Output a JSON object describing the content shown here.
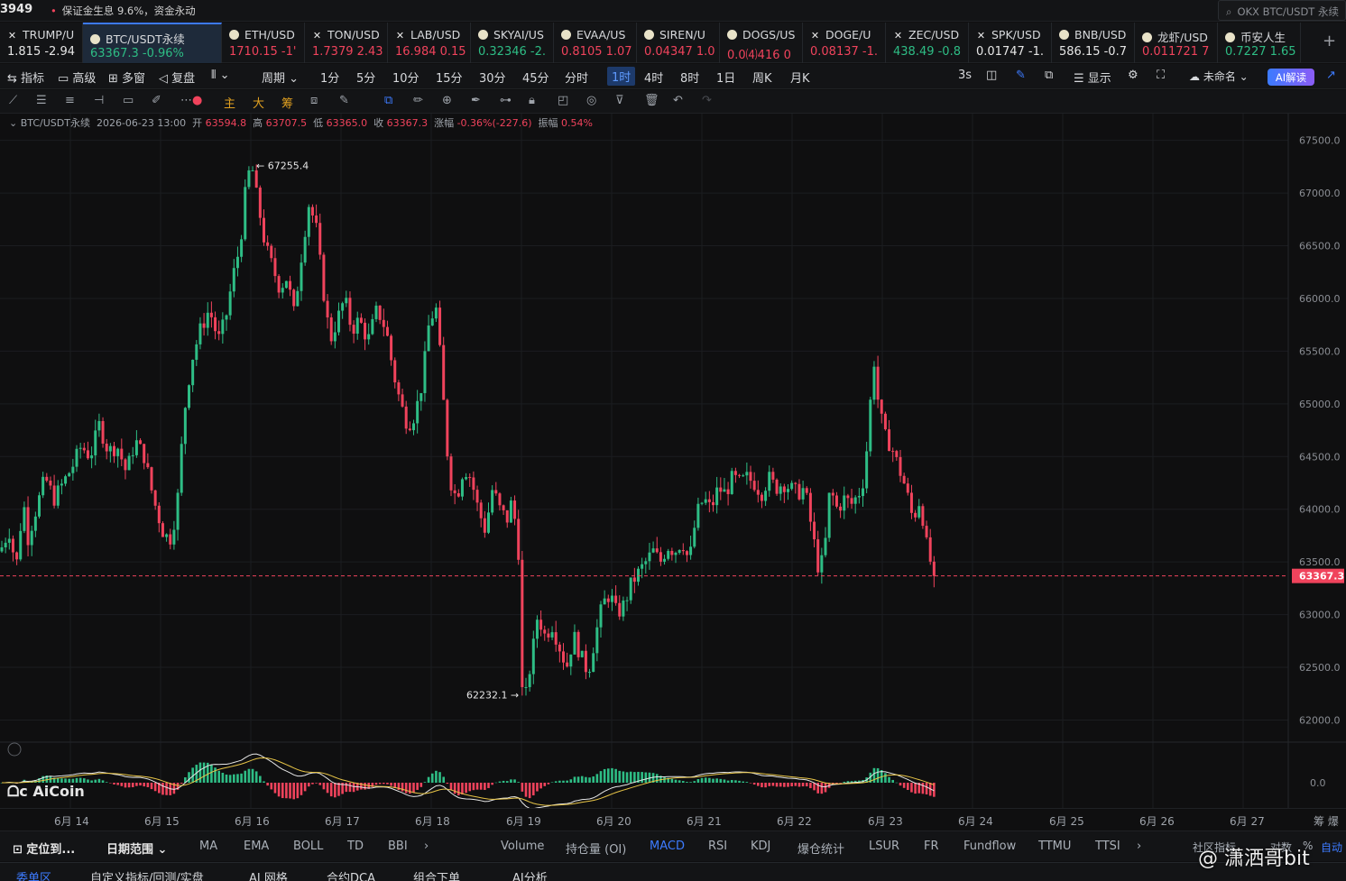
{
  "topbar": {
    "left_price": "3949",
    "notice": "保证金生息 9.6%，资金永动",
    "search_placeholder": "OKX BTC/USDT 永续"
  },
  "tickers": [
    {
      "name": "TRUMP/U",
      "value": "1.815  -2.94",
      "icon": "close-icon",
      "trend": "wt"
    },
    {
      "name": "BTC/USDT永续",
      "value": "63367.3  -0.96%",
      "icon": "coin-icon",
      "trend": "up",
      "active": true
    },
    {
      "name": "ETH/USD",
      "value": "1710.15  -1'",
      "icon": "coin-icon",
      "trend": "dn"
    },
    {
      "name": "TON/USD",
      "value": "1.7379  2.43",
      "icon": "close-icon",
      "trend": "dn"
    },
    {
      "name": "LAB/USD",
      "value": "16.984  0.15",
      "icon": "close-icon",
      "trend": "dn"
    },
    {
      "name": "SKYAI/US",
      "value": "0.32346  -2.",
      "icon": "coin-icon",
      "trend": "up"
    },
    {
      "name": "EVAA/US",
      "value": "0.8105  1.07",
      "icon": "coin-icon",
      "trend": "dn"
    },
    {
      "name": "SIREN/U",
      "value": "0.04347  1.0",
      "icon": "coin-icon",
      "trend": "dn"
    },
    {
      "name": "DOGS/US",
      "value": "0.0⑷416  0",
      "icon": "coin-icon",
      "trend": "dn"
    },
    {
      "name": "DOGE/U",
      "value": "0.08137  -1.",
      "icon": "close-icon",
      "trend": "dn"
    },
    {
      "name": "ZEC/USD",
      "value": "438.49  -0.8",
      "icon": "close-icon",
      "trend": "up"
    },
    {
      "name": "SPK/USD",
      "value": "0.01747  -1.",
      "icon": "close-icon",
      "trend": "wt"
    },
    {
      "name": "BNB/USD",
      "value": "586.15  -0.7",
      "icon": "coin-icon",
      "trend": "wt"
    },
    {
      "name": "龙虾/USD",
      "value": "0.011721  7",
      "icon": "coin-icon",
      "trend": "dn"
    },
    {
      "name": "币安人生",
      "value": "0.7227  1.65",
      "icon": "coin-icon",
      "trend": "up"
    }
  ],
  "toolbar": {
    "indicators": "指标",
    "advanced": "高级",
    "multi": "多窗",
    "replay": "复盘",
    "period": "周期",
    "intervals": [
      "1分",
      "5分",
      "10分",
      "15分",
      "30分",
      "45分",
      "分时",
      "1时",
      "4时",
      "8时",
      "1日",
      "周K",
      "月K"
    ],
    "selected_interval": "1时",
    "refresh": "3s",
    "display": "显示",
    "unnamed": "未命名",
    "ai_button": "AI解读"
  },
  "drawing_tools": {
    "main": "主",
    "big": "大",
    "chip": "筹"
  },
  "ohlc": {
    "symbol": "BTC/USDT永续",
    "time": "2026-06-23 13:00",
    "open_label": "开",
    "open": "63594.8",
    "high_label": "高",
    "high": "63707.5",
    "low_label": "低",
    "low": "63365.0",
    "close_label": "收",
    "close": "63367.3",
    "change_label": "涨幅",
    "change": "-0.36%(-227.6)",
    "amp_label": "振幅",
    "amp": "0.54%"
  },
  "chart_data": {
    "type": "candlestick",
    "y_ticks": [
      67500,
      67000,
      66500,
      66000,
      65500,
      65000,
      64500,
      64000,
      63500,
      63000,
      62500,
      62000
    ],
    "y_tick_labels": [
      "67500.0",
      "67000.0",
      "66500.0",
      "66000.0",
      "65500.0",
      "65000.0",
      "64500.0",
      "64000.0",
      "63500.0",
      "63000.0",
      "62500.0",
      "62000.0"
    ],
    "ylim": [
      61850,
      67600
    ],
    "x_labels": [
      "6月 14",
      "6月 15",
      "6月 16",
      "6月 17",
      "6月 18",
      "6月 19",
      "6月 20",
      "6月 21",
      "6月 22",
      "6月 23",
      "6月 24",
      "6月 25",
      "6月 26",
      "6月 27"
    ],
    "annotations": {
      "max": "67255.4",
      "max_value": 67255.4,
      "min": "62232.1",
      "min_value": 62232.1
    },
    "last_price": 63367.3,
    "last_price_label": "63367.3",
    "path": [
      [
        0,
        63600
      ],
      [
        10,
        63800
      ],
      [
        18,
        63450
      ],
      [
        26,
        64100
      ],
      [
        30,
        63700
      ],
      [
        40,
        64000
      ],
      [
        50,
        64300
      ],
      [
        60,
        64100
      ],
      [
        70,
        64250
      ],
      [
        80,
        64400
      ],
      [
        90,
        64600
      ],
      [
        100,
        64500
      ],
      [
        110,
        64800
      ],
      [
        120,
        64550
      ],
      [
        130,
        64600
      ],
      [
        140,
        64350
      ],
      [
        150,
        64650
      ],
      [
        160,
        64500
      ],
      [
        170,
        64100
      ],
      [
        180,
        63800
      ],
      [
        188,
        63700
      ],
      [
        196,
        64000
      ],
      [
        204,
        64900
      ],
      [
        212,
        65400
      ],
      [
        222,
        65700
      ],
      [
        232,
        65900
      ],
      [
        242,
        65600
      ],
      [
        250,
        65800
      ],
      [
        258,
        66200
      ],
      [
        266,
        66500
      ],
      [
        272,
        67000
      ],
      [
        278,
        67250
      ],
      [
        286,
        66900
      ],
      [
        294,
        66500
      ],
      [
        302,
        66300
      ],
      [
        310,
        66100
      ],
      [
        318,
        66200
      ],
      [
        326,
        65850
      ],
      [
        334,
        66400
      ],
      [
        342,
        66900
      ],
      [
        350,
        66700
      ],
      [
        358,
        66100
      ],
      [
        366,
        65600
      ],
      [
        374,
        65800
      ],
      [
        382,
        66000
      ],
      [
        390,
        65700
      ],
      [
        398,
        65800
      ],
      [
        408,
        65600
      ],
      [
        418,
        65900
      ],
      [
        428,
        65700
      ],
      [
        436,
        65300
      ],
      [
        444,
        65000
      ],
      [
        452,
        64800
      ],
      [
        460,
        64900
      ],
      [
        468,
        65200
      ],
      [
        476,
        65800
      ],
      [
        484,
        65900
      ],
      [
        490,
        65200
      ],
      [
        498,
        64300
      ],
      [
        506,
        64100
      ],
      [
        514,
        64400
      ],
      [
        522,
        64300
      ],
      [
        530,
        64000
      ],
      [
        538,
        63800
      ],
      [
        546,
        64200
      ],
      [
        554,
        64000
      ],
      [
        562,
        63900
      ],
      [
        568,
        64100
      ],
      [
        576,
        63500
      ],
      [
        580,
        62300
      ],
      [
        588,
        62500
      ],
      [
        596,
        63000
      ],
      [
        604,
        62800
      ],
      [
        612,
        62900
      ],
      [
        620,
        62700
      ],
      [
        628,
        62500
      ],
      [
        636,
        62800
      ],
      [
        644,
        62600
      ],
      [
        652,
        62450
      ],
      [
        660,
        62800
      ],
      [
        668,
        63100
      ],
      [
        676,
        63200
      ],
      [
        684,
        63000
      ],
      [
        692,
        63100
      ],
      [
        700,
        63300
      ],
      [
        708,
        63400
      ],
      [
        716,
        63500
      ],
      [
        724,
        63600
      ],
      [
        732,
        63500
      ],
      [
        740,
        63650
      ],
      [
        748,
        63600
      ],
      [
        756,
        63700
      ],
      [
        764,
        63500
      ],
      [
        772,
        63950
      ],
      [
        780,
        64100
      ],
      [
        788,
        64000
      ],
      [
        796,
        64200
      ],
      [
        804,
        64150
      ],
      [
        812,
        64300
      ],
      [
        820,
        64250
      ],
      [
        828,
        64300
      ],
      [
        836,
        64250
      ],
      [
        844,
        64150
      ],
      [
        852,
        64300
      ],
      [
        860,
        64200
      ],
      [
        868,
        64250
      ],
      [
        876,
        64200
      ],
      [
        884,
        64150
      ],
      [
        892,
        64200
      ],
      [
        900,
        63800
      ],
      [
        908,
        63400
      ],
      [
        914,
        63600
      ],
      [
        920,
        64200
      ],
      [
        928,
        64000
      ],
      [
        936,
        64100
      ],
      [
        944,
        64050
      ],
      [
        952,
        64150
      ],
      [
        958,
        64300
      ],
      [
        964,
        64900
      ],
      [
        968,
        65500
      ],
      [
        972,
        65100
      ],
      [
        980,
        64700
      ],
      [
        988,
        64600
      ],
      [
        996,
        64400
      ],
      [
        1004,
        64200
      ],
      [
        1012,
        63900
      ],
      [
        1020,
        64100
      ],
      [
        1028,
        63600
      ],
      [
        1036,
        63367
      ]
    ],
    "macd": {
      "zero_label": "0.0"
    }
  },
  "watermark": "AiCoin",
  "indicator_bar": {
    "locate": "定位到...",
    "date_range": "日期范围",
    "main_indicators": [
      "MA",
      "EMA",
      "BOLL",
      "TD",
      "BBI"
    ],
    "sub_indicators": [
      "Volume",
      "持仓量 (OI)",
      "MACD",
      "RSI",
      "KDJ",
      "爆仓统计",
      "LSUR",
      "FR",
      "Fundflow",
      "TTMU",
      "TTSI"
    ],
    "selected_sub": "MACD",
    "community": "社区指标",
    "compare": "对数",
    "percent": "%",
    "auto": "自动"
  },
  "bottom_tabs": [
    "委单区",
    "自定义指标/回测/实盘",
    "AI 网格",
    "合约DCA",
    "组合下单",
    "AI分析"
  ],
  "selected_bottom_tab": "委单区",
  "brand": "@ 潇洒哥bit",
  "colors": {
    "up": "#2ebd85",
    "down": "#f0435c",
    "accent": "#3d7bff",
    "bg": "#0f0f10"
  }
}
